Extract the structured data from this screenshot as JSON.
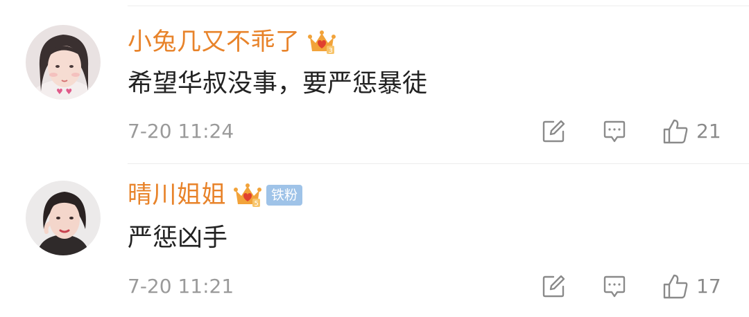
{
  "colors": {
    "username": "#e8832a",
    "content_text": "#222222",
    "meta_text": "#9a9a9a",
    "icon_gray": "#8a8a8a",
    "crown_gold": "#f2a33a",
    "crown_heart": "#e0402f",
    "fan_badge_bg": "#9fc3e8",
    "divider": "#ececec"
  },
  "comments": [
    {
      "username": "小兔几又不乖了",
      "crown_icon": "vip-crown-icon",
      "crown_level": "3",
      "fan_badge": null,
      "content": "希望华叔没事，要严惩暴徒",
      "timestamp": "7-20 11:24",
      "actions": {
        "repost_icon": "repost-edit-icon",
        "reply_icon": "comment-bubble-icon",
        "like_icon": "thumbs-up-icon",
        "like_count": "21"
      }
    },
    {
      "username": "晴川姐姐",
      "crown_icon": "vip-crown-icon",
      "crown_level": "5",
      "fan_badge": "铁粉",
      "content": "严惩凶手",
      "timestamp": "7-20 11:21",
      "actions": {
        "repost_icon": "repost-edit-icon",
        "reply_icon": "comment-bubble-icon",
        "like_icon": "thumbs-up-icon",
        "like_count": "17"
      }
    }
  ]
}
